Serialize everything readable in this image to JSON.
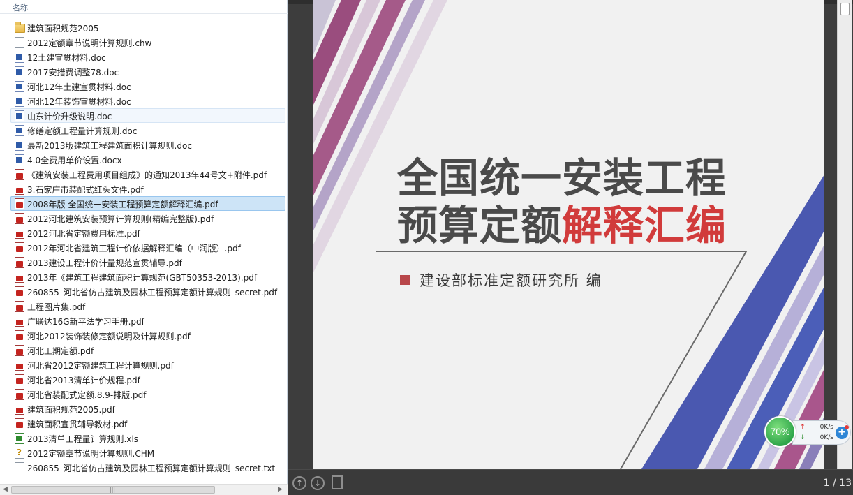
{
  "file_list": {
    "column_header": "名称",
    "items": [
      {
        "name": "建筑面积规范2005",
        "icon": "folder-icon"
      },
      {
        "name": "2012定额章节说明计算规则.chw",
        "icon": "blank-file-icon"
      },
      {
        "name": "12土建宣贯材料.doc",
        "icon": "word-doc-icon"
      },
      {
        "name": "2017安措费调整78.doc",
        "icon": "word-doc-icon"
      },
      {
        "name": "河北12年土建宣贯材料.doc",
        "icon": "word-doc-icon"
      },
      {
        "name": "河北12年装饰宣贯材料.doc",
        "icon": "word-doc-icon"
      },
      {
        "name": "山东计价升级说明.doc",
        "icon": "word-doc-icon"
      },
      {
        "name": "修缮定额工程量计算规则.doc",
        "icon": "word-doc-icon"
      },
      {
        "name": "最新2013版建筑工程建筑面积计算规则.doc",
        "icon": "word-doc-icon"
      },
      {
        "name": "4.0全费用单价设置.docx",
        "icon": "word-doc-icon"
      },
      {
        "name": "《建筑安装工程费用项目组成》的通知2013年44号文+附件.pdf",
        "icon": "pdf-icon"
      },
      {
        "name": "3.石家庄市装配式红头文件.pdf",
        "icon": "pdf-icon"
      },
      {
        "name": "2008年版 全国统一安装工程预算定额解释汇编.pdf",
        "icon": "pdf-icon"
      },
      {
        "name": "2012河北建筑安装预算计算规则(精编完整版).pdf",
        "icon": "pdf-icon"
      },
      {
        "name": "2012河北省定额费用标准.pdf",
        "icon": "pdf-icon"
      },
      {
        "name": "2012年河北省建筑工程计价依据解释汇编（中润版）.pdf",
        "icon": "pdf-icon"
      },
      {
        "name": "2013建设工程计价计量规范宣贯辅导.pdf",
        "icon": "pdf-icon"
      },
      {
        "name": "2013年《建筑工程建筑面积计算规范(GBT50353-2013).pdf",
        "icon": "pdf-icon"
      },
      {
        "name": "260855_河北省仿古建筑及园林工程预算定额计算规则_secret.pdf",
        "icon": "pdf-icon"
      },
      {
        "name": "工程图片集.pdf",
        "icon": "pdf-icon"
      },
      {
        "name": "广联达16G新平法学习手册.pdf",
        "icon": "pdf-icon"
      },
      {
        "name": "河北2012装饰装修定额说明及计算规则.pdf",
        "icon": "pdf-icon"
      },
      {
        "name": "河北工期定额.pdf",
        "icon": "pdf-icon"
      },
      {
        "name": "河北省2012定额建筑工程计算规则.pdf",
        "icon": "pdf-icon"
      },
      {
        "name": "河北省2013清单计价规程.pdf",
        "icon": "pdf-icon"
      },
      {
        "name": "河北省装配式定额.8.9-排版.pdf",
        "icon": "pdf-icon"
      },
      {
        "name": "建筑面积规范2005.pdf",
        "icon": "pdf-icon"
      },
      {
        "name": "建筑面积宣贯辅导教材.pdf",
        "icon": "pdf-icon"
      },
      {
        "name": "2013清单工程量计算规则.xls",
        "icon": "excel-icon"
      },
      {
        "name": "2012定额章节说明计算规则.CHM",
        "icon": "chm-help-icon"
      },
      {
        "name": "260855_河北省仿古建筑及园林工程预算定额计算规则_secret.txt",
        "icon": "text-file-icon"
      }
    ],
    "hover_index": 6,
    "selected_index": 12
  },
  "viewer": {
    "cover": {
      "title_line1": "全国统一安装工程",
      "title_line2_dark": "预算定额",
      "title_line2_red": "解释汇编",
      "publisher": "建设部标准定额研究所 编"
    },
    "toolbar": {
      "prev_icon": "arrow-up-icon",
      "next_icon": "arrow-down-icon",
      "doc_icon": "document-icon",
      "page_counter": "1 / 13"
    }
  },
  "net_widget": {
    "percent": "70%",
    "upload": "0K/s",
    "download": "0K/s"
  },
  "colors": {
    "selected_row": "#cde4f7",
    "stripe_purple": "#9a4d7e",
    "stripe_blue": "#3c4fa8",
    "title_red": "#d13b3b"
  }
}
